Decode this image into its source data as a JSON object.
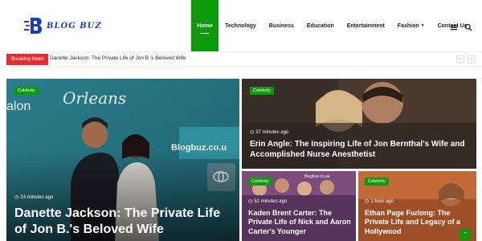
{
  "header": {
    "logo_text": "BLOG BUZ",
    "nav": [
      {
        "label": "Home"
      },
      {
        "label": "Technology"
      },
      {
        "label": "Business"
      },
      {
        "label": "Education"
      },
      {
        "label": "Entertainment"
      },
      {
        "label": "Fashion"
      },
      {
        "label": "Contact Us"
      }
    ]
  },
  "breaking": {
    "label": "Breaking News",
    "headline": "Danette Jackson: The Private Life of Jon B.'s Beloved Wife"
  },
  "cards": [
    {
      "category": "Celebrity",
      "time": "24 minutes ago",
      "title": "Danette Jackson: The Private Life of Jon B.'s Beloved Wife",
      "bg_text_top": "Orleans",
      "bg_text_mid": "Blogbuz.co.u",
      "bg_text_left": "alon"
    },
    {
      "category": "Celebrity",
      "time": "37 minutes ago",
      "title": "Erin Angle: The Inspiring Life of Jon Bernthal's Wife and Accomplished Nurse Anesthetist"
    },
    {
      "category": "Celebrity",
      "time": "52 minutes ago",
      "title": "Kaden Brent Carter: The Private Life of Nick and Aaron Carter's Younger",
      "bg_text": "Blogbuz.co.uk"
    },
    {
      "category": "Celebrity",
      "time": "1 hour ago",
      "title": "Ethan Page Furlong: The Private Life and Legacy of a Hollywood"
    }
  ],
  "colors": {
    "accent": "#0a9a0a",
    "breaking": "#e42e2e",
    "brand": "#1d3fb0"
  }
}
